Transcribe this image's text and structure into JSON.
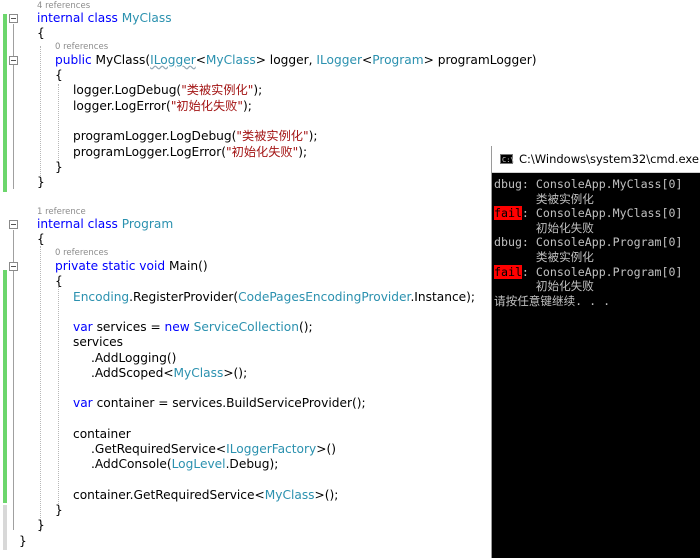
{
  "codelens": {
    "myclass_refs": "4 references",
    "ctor_refs": "0 references",
    "program_refs": "1 reference",
    "main_refs": "0 references"
  },
  "code": {
    "l1_kw": "internal class ",
    "l1_name": "MyClass",
    "open_brace": "{",
    "close_brace": "}",
    "l3_kw": "public ",
    "l3_name": "MyClass(",
    "ilogger": "ILogger",
    "lt": "<",
    "myclass": "MyClass",
    "l3_mid": "> logger, ",
    "program": "Program",
    "l3_end": "> programLogger)",
    "l5_a": "logger.LogDebug(",
    "l5_s": "\"类被实例化\"",
    "l5_b": ");",
    "l6_a": "logger.LogError(",
    "l6_s": "\"初始化失败\"",
    "l6_b": ");",
    "l8_a": "programLogger.LogDebug(",
    "l8_s": "\"类被实例化\"",
    "l8_b": ");",
    "l9_a": "programLogger.LogError(",
    "l9_s": "\"初始化失败\"",
    "l9_b": ");",
    "p1_kw": "internal class ",
    "p1_name": "Program",
    "main_kw": "private static void ",
    "main_name": "Main()",
    "enc_type": "Encoding",
    "enc_mid": ".RegisterProvider(",
    "enc_type2": "CodePagesEncodingProvider",
    "enc_end": ".Instance);",
    "var_kw": "var",
    "services_decl": " services = ",
    "new_kw": "new ",
    "sc_type": "ServiceCollection",
    "sc_end": "();",
    "services": "services",
    "add_logging": ".AddLogging()",
    "add_scoped": ".AddScoped<",
    "add_scoped_end": ">();",
    "container_decl": " container = services.BuildServiceProvider();",
    "container": "container",
    "get_req": ".GetRequiredService<",
    "ilf": "ILoggerFactory",
    "get_req_end": ">()",
    "add_console": ".AddConsole(",
    "loglevel": "LogLevel",
    "debug_end": ".Debug);",
    "final_a": "container.GetRequiredService<",
    "final_end": ">();"
  },
  "console": {
    "title": "C:\\Windows\\system32\\cmd.exe",
    "icon_text": "C:\\",
    "lines": [
      {
        "tag": "dbug",
        "text": ": ConsoleApp.MyClass[0]"
      },
      {
        "msg": "      类被实例化"
      },
      {
        "tag": "fail",
        "text": ": ConsoleApp.MyClass[0]"
      },
      {
        "msg": "      初始化失败"
      },
      {
        "tag": "dbug",
        "text": ": ConsoleApp.Program[0]"
      },
      {
        "msg": "      类被实例化"
      },
      {
        "tag": "fail",
        "text": ": ConsoleApp.Program[0]"
      },
      {
        "msg": "      初始化失败"
      },
      {
        "msg": "请按任意键继续. . ."
      }
    ]
  },
  "colors": {
    "keyword": "#0000ff",
    "type": "#2b91af",
    "string": "#a31515",
    "changed_bar": "#6cd66c",
    "console_bg": "#000000",
    "console_fg": "#c0c0c0",
    "fail_bg": "#ff0000"
  }
}
